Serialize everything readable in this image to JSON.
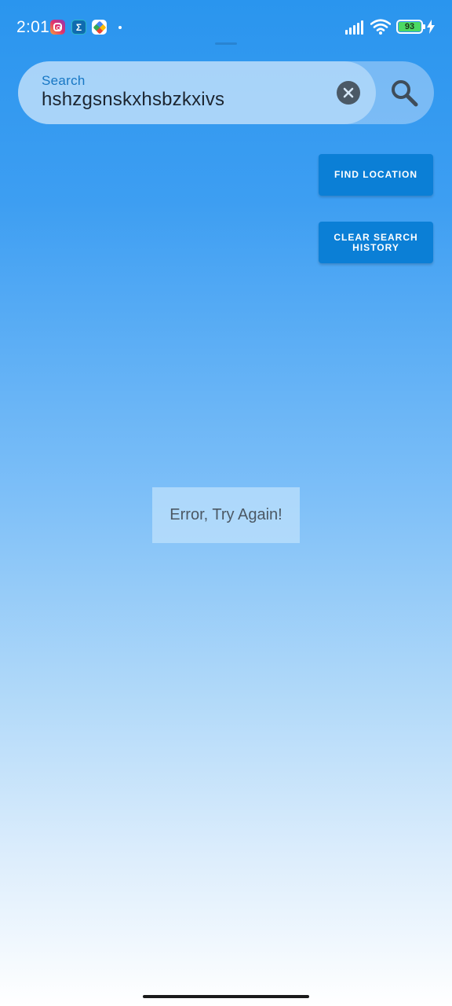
{
  "status_bar": {
    "time": "2:01",
    "battery_level": "93",
    "icons": [
      "instagram-icon",
      "sigma-app-icon",
      "google-photos-icon",
      "notification-dot",
      "signal-icon",
      "wifi-icon",
      "battery-icon",
      "charging-bolt-icon"
    ]
  },
  "search": {
    "label": "Search",
    "value": "hshzgsnskxhsbzkxivs"
  },
  "buttons": {
    "find_location": "FIND LOCATION",
    "clear_search_history": "CLEAR SEARCH HISTORY"
  },
  "message": {
    "error_text": "Error, Try Again!"
  },
  "colors": {
    "button": "#0b7fd6",
    "search_label": "#1777c4",
    "gradient_top": "#2a95ee",
    "gradient_bottom": "#ffffff"
  }
}
